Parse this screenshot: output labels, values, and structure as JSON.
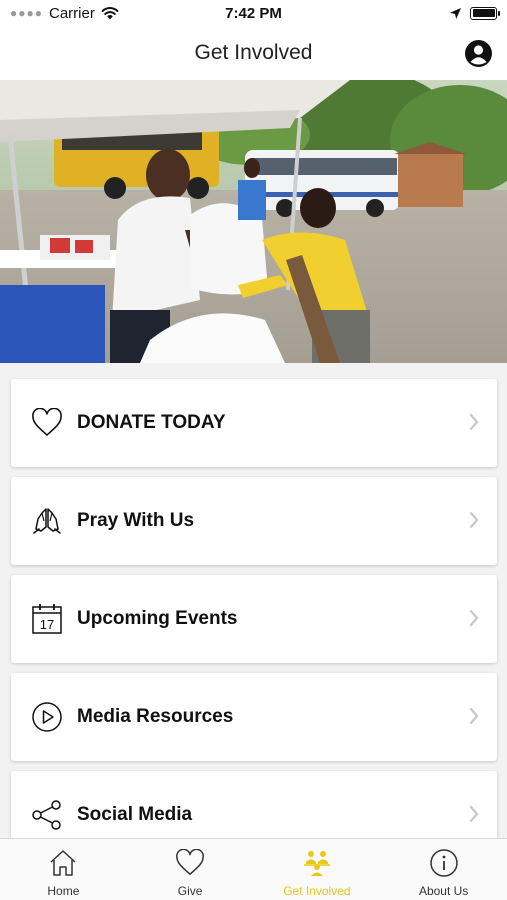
{
  "status_bar": {
    "carrier": "Carrier",
    "time": "7:42 PM"
  },
  "nav": {
    "title": "Get Involved"
  },
  "colors": {
    "accent": "#e8c81b",
    "card_text": "#111111",
    "chevron": "#c7c7cc"
  },
  "cards": [
    {
      "label": "DONATE TODAY",
      "icon": "heart-icon"
    },
    {
      "label": "Pray With Us",
      "icon": "praying-hands-icon"
    },
    {
      "label": "Upcoming Events",
      "icon": "calendar-icon",
      "icon_text": "17"
    },
    {
      "label": "Media Resources",
      "icon": "play-circle-icon"
    },
    {
      "label": "Social Media",
      "icon": "share-icon"
    }
  ],
  "tabs": [
    {
      "label": "Home",
      "icon": "home-icon",
      "active": false
    },
    {
      "label": "Give",
      "icon": "heart-icon",
      "active": false
    },
    {
      "label": "Get Involved",
      "icon": "people-icon",
      "active": true
    },
    {
      "label": "About Us",
      "icon": "info-icon",
      "active": false
    }
  ]
}
